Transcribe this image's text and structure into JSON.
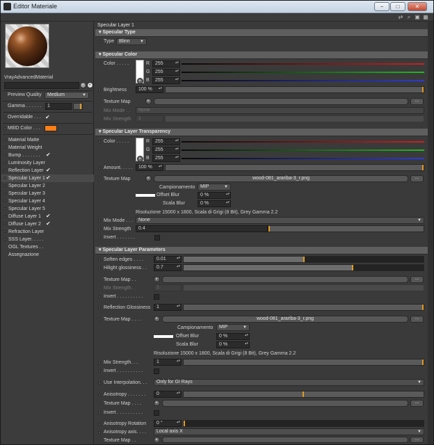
{
  "window": {
    "title": "Editor Materiale",
    "btn_min": "−",
    "btn_max": "□",
    "btn_close": "✕"
  },
  "colors": {
    "accent": "#e39a1d",
    "mtl_id": "#ff7f16",
    "red": "#cc2020",
    "green": "#22b822",
    "blue": "#2c3ad8"
  },
  "left": {
    "material_name": "VrayAdvancedMaterial",
    "preview_quality_label": "Preview Quality",
    "preview_quality_value": "Medium",
    "gamma_label": "Gamma . . . . . .",
    "gamma_value": "1",
    "overridable_label": "Overridable . . .",
    "overridable_check": "✔",
    "mtlid_label": "MtlID Color . . .",
    "channels": [
      {
        "label": "Material Matte",
        "checked": ""
      },
      {
        "label": "Material Weight",
        "checked": ""
      },
      {
        "label": "Bump . . . . . . .",
        "checked": "✔"
      },
      {
        "label": "Luminosity Layer",
        "checked": ""
      },
      {
        "label": "Reflection Layer",
        "checked": "✔"
      },
      {
        "label": "Specular Layer 1",
        "checked": "✔"
      },
      {
        "label": "Specular Layer 2",
        "checked": ""
      },
      {
        "label": "Specular Layer 3",
        "checked": ""
      },
      {
        "label": "Specular Layer 4",
        "checked": ""
      },
      {
        "label": "Specular Layer 5",
        "checked": ""
      },
      {
        "label": "Diffuse Layer 1",
        "checked": "✔"
      },
      {
        "label": "Diffuse Layer 2",
        "checked": "✔"
      },
      {
        "label": "Refraction Layer",
        "checked": ""
      },
      {
        "label": "SSS Layer. . . . .",
        "checked": ""
      },
      {
        "label": "OGL Textures . .",
        "checked": ""
      },
      {
        "label": "Assegnazione",
        "checked": ""
      }
    ]
  },
  "right": {
    "layer_title": "Specular Layer 1",
    "sec_type": "▾ Specular Type",
    "type_label": "Type",
    "type_value": "Blinn",
    "sec_color": "▾ Specular Color",
    "color_label": "Color . . . . .",
    "r_label": "R",
    "g_label": "G",
    "b_label": "B",
    "r_value": "255",
    "g_value": "255",
    "b_value": "255",
    "brightness_label": "Brightness",
    "brightness_value": "100 %",
    "texture_map_label": "Texture Map",
    "mix_mode_label": "Mix Mode . .",
    "mix_mode_value": "None",
    "mix_strength_label": "Mix Strength",
    "mix_strength_value": "1",
    "sec_transp": "▾ Specular Layer Transparency",
    "amount_label": "Amount. . . . .",
    "amount_value": "100 %",
    "tex_map_file": "wood-081_arariba-3_r.png",
    "campionamento_label": "Campionamento",
    "campionamento_value": "MIP",
    "offset_blur_label": "Offset Blur",
    "offset_blur_value": "0 %",
    "scala_blur_label": "Scala Blur",
    "scala_blur_value": "0 %",
    "resolution": "Risoluzione 15000 x 1800, Scala di Grigi (8 Bit), Grey Gamma 2.2",
    "mix_mode2_label": "Mix Mode . . .",
    "mix_mode2_value": "None",
    "mix_strength2_label": "Mix Strength",
    "mix_strength2_value": "0.4",
    "invert_label": "Invert . . . . . . .",
    "sec_params": "▾ Specular Layer Parameters",
    "soften_label": "Soften edges . . . .",
    "soften_value": "0.01",
    "hilight_label": "Hilight glossiness . .",
    "hilight_value": "0.7",
    "texture_map2_label": "Texture Map . .",
    "mix_strength3_label": "Mix Strength. .",
    "mix_strength3_value": "1",
    "invert2_label": "Invert . . . . . . . . . .",
    "refl_gloss_label": "Reflection Glossiness",
    "refl_gloss_value": "1",
    "texture_map3_label": "Texture Map . . . .",
    "mix_strength4_label": "Mix Strength. . .",
    "mix_strength4_value": "1",
    "invert3_label": "Invert . . . . . . . . . .",
    "use_interp_label": "Use Interpolation. . .",
    "use_interp_value": "Only for GI Rays",
    "anisotropy_label": "Anisotropy . . . . . . .",
    "anisotropy_value": "0",
    "texture_map4_label": "Texture Map . . . .",
    "invert4_label": "Invert . . . . . . . . . .",
    "aniso_rot_label": "Anisotropy Rotation",
    "aniso_rot_value": "0 °",
    "aniso_axis_label": "Anisotropy axis. . . .",
    "aniso_axis_value": "Local axis X",
    "texture_map5_label": "Texture Map . .",
    "dots": "...",
    "arrow": "▸"
  }
}
